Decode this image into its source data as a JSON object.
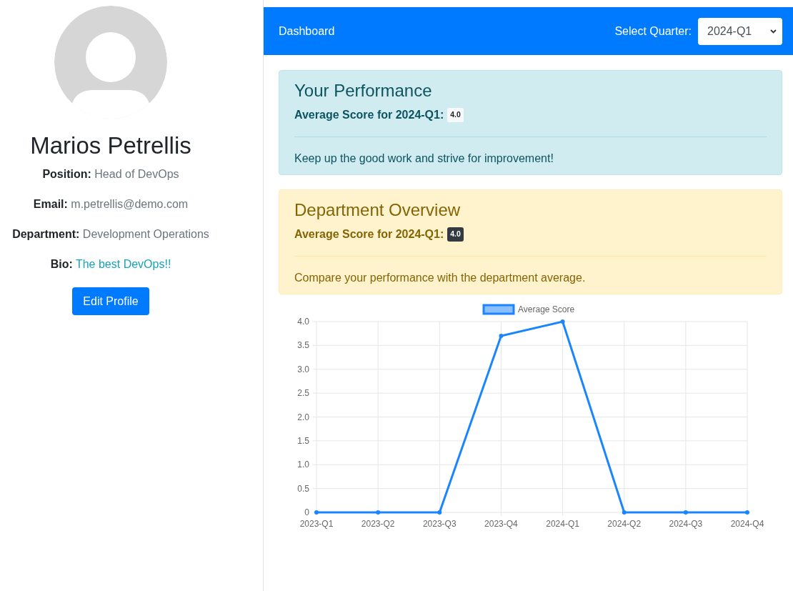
{
  "profile": {
    "name": "Marios Petrellis",
    "fields": [
      {
        "label": "Position:",
        "value": "Head of DevOps",
        "kind": "text"
      },
      {
        "label": "Email:",
        "value": "m.petrellis@demo.com",
        "kind": "text"
      },
      {
        "label": "Department:",
        "value": "Development Operations",
        "kind": "text"
      },
      {
        "label": "Bio:",
        "value": "The best DevOps!!",
        "kind": "link"
      }
    ],
    "edit_button": "Edit Profile"
  },
  "navbar": {
    "brand": "Dashboard",
    "quarter_label": "Select Quarter:",
    "quarter_value": "2024-Q1"
  },
  "cards": [
    {
      "kind": "info",
      "title": "Your Performance",
      "score_label": "Average Score for 2024-Q1:",
      "score": "4.0",
      "message": "Keep up the good work and strive for improvement!"
    },
    {
      "kind": "warning",
      "title": "Department Overview",
      "score_label": "Average Score for 2024-Q1:",
      "score": "4.0",
      "message": "Compare your performance with the department average."
    }
  ],
  "chart_data": {
    "type": "line",
    "categories": [
      "2023-Q1",
      "2023-Q2",
      "2023-Q3",
      "2023-Q4",
      "2024-Q1",
      "2024-Q2",
      "2024-Q3",
      "2024-Q4"
    ],
    "series": [
      {
        "name": "Average Score",
        "color": "#1a85ff",
        "values": [
          0,
          0,
          0,
          3.7,
          4,
          0,
          0,
          0
        ]
      }
    ],
    "ylim": [
      0,
      4
    ],
    "grid": true,
    "marker": true,
    "yticks": [
      0,
      0.5,
      {
        "value": 1,
        "label": "1.0"
      },
      1.5,
      {
        "value": 2,
        "label": "2.0"
      },
      2.5,
      {
        "value": 3,
        "label": "3.0"
      },
      3.5,
      {
        "value": 4,
        "label": "4.0"
      }
    ]
  }
}
